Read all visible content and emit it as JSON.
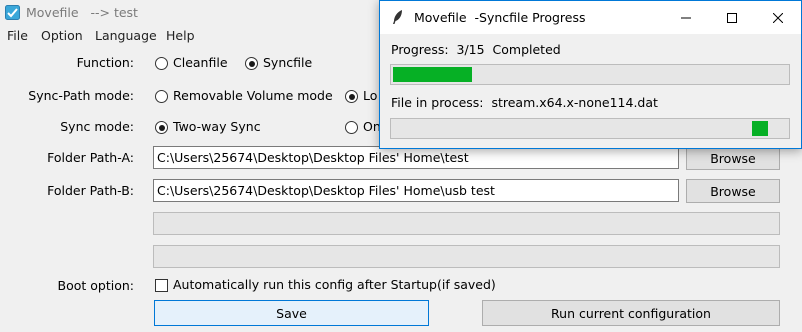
{
  "main_window": {
    "title": "Movefile   --> test",
    "menu": [
      "File",
      "Option",
      "Language",
      "Help"
    ],
    "function": {
      "label": "Function:",
      "options": [
        "Cleanfile",
        "Syncfile"
      ],
      "selected": "Syncfile"
    },
    "sync_path_mode": {
      "label": "Sync-Path mode:",
      "options": [
        "Removable Volume mode",
        "Lo"
      ],
      "selected": "Lo"
    },
    "sync_mode": {
      "label": "Sync mode:",
      "options": [
        "Two-way Sync",
        "On"
      ],
      "selected": "Two-way Sync"
    },
    "folder_a": {
      "label": "Folder Path-A:",
      "value": "C:\\Users\\25674\\Desktop\\Desktop Files' Home\\test",
      "browse_label": "Browse"
    },
    "folder_b": {
      "label": "Folder Path-B:",
      "value": "C:\\Users\\25674\\Desktop\\Desktop Files' Home\\usb test",
      "browse_label": "Browse"
    },
    "boot_option": {
      "label": "Boot option:",
      "checkbox_label": "Automatically run this config after Startup(if saved)",
      "checked": false
    },
    "save_label": "Save",
    "run_label": "Run current configuration"
  },
  "progress_dialog": {
    "title": "Movefile  -Syncfile Progress",
    "progress_text": "Progress:  3/15  Completed",
    "progress_fraction": 0.2,
    "file_text": "File in process:  stream.x64.x-none114.dat",
    "file_progress_fraction": 0.95,
    "accent_color": "#06b025",
    "border_color": "#0078d7",
    "icons": [
      "feather-icon",
      "minimize-icon",
      "maximize-icon",
      "close-icon"
    ]
  }
}
